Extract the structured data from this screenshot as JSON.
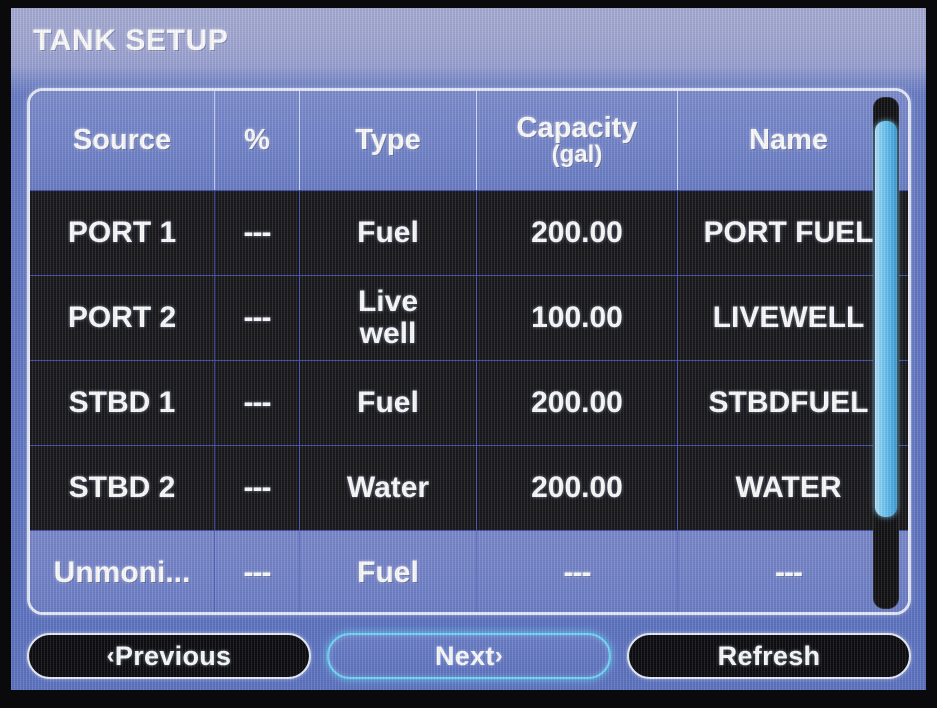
{
  "screen": {
    "title": "TANK SETUP"
  },
  "table": {
    "columns": [
      {
        "key": "source",
        "label": "Source"
      },
      {
        "key": "percent",
        "label": "%"
      },
      {
        "key": "type",
        "label": "Type"
      },
      {
        "key": "capacity",
        "label": "Capacity",
        "sublabel": "(gal)"
      },
      {
        "key": "name",
        "label": "Name"
      }
    ],
    "rows": [
      {
        "source": "PORT 1",
        "percent": "---",
        "type": "Fuel",
        "capacity": "200.00",
        "name": "PORT FUEL",
        "selected": false
      },
      {
        "source": "PORT 2",
        "percent": "---",
        "type": "Live\nwell",
        "capacity": "100.00",
        "name": "LIVEWELL",
        "selected": false
      },
      {
        "source": "STBD 1",
        "percent": "---",
        "type": "Fuel",
        "capacity": "200.00",
        "name": "STBDFUEL",
        "selected": false
      },
      {
        "source": "STBD 2",
        "percent": "---",
        "type": "Water",
        "capacity": "200.00",
        "name": "WATER",
        "selected": false
      },
      {
        "source": "Unmoni...",
        "percent": "---",
        "type": "Fuel",
        "capacity": "---",
        "name": "---",
        "selected": true
      }
    ]
  },
  "scrollbar": {
    "position_percent": 20,
    "thumb_size_percent": 78
  },
  "buttons": [
    {
      "id": "previous",
      "label": "Previous",
      "chevron_left": "‹",
      "chevron_right": "",
      "focused": false
    },
    {
      "id": "next",
      "label": "Next",
      "chevron_left": "",
      "chevron_right": "›",
      "focused": true
    },
    {
      "id": "refresh",
      "label": "Refresh",
      "chevron_left": "",
      "chevron_right": "",
      "focused": false
    }
  ],
  "colors": {
    "panel_blue": "#6478c6",
    "panel_light": "#a9aed8",
    "row_dark": "#18181c",
    "selection_blue": "#6d7fc9",
    "border_white": "#e8edfb",
    "focus_cyan": "#74d8fb",
    "grid_line": "#3b47a8"
  }
}
